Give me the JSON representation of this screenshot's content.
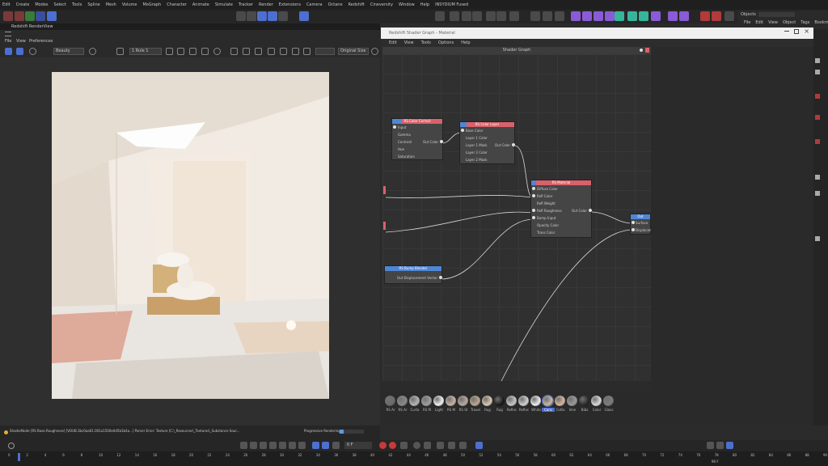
{
  "menubar": [
    "Edit",
    "Create",
    "Modes",
    "Select",
    "Tools",
    "Spline",
    "Mesh",
    "Volume",
    "MoGraph",
    "Character",
    "Animate",
    "Simulate",
    "Tracker",
    "Render",
    "Extensions",
    "Camera",
    "Octane",
    "Redshift",
    "Cineversity",
    "Window",
    "Help",
    "INSYDIUM Fused"
  ],
  "renderview": {
    "title": "Redshift RenderView",
    "menu": [
      "File",
      "View",
      "Preferences"
    ],
    "display_mode": "Beauty",
    "camera_select": "1 Rule 1",
    "color_select": "Original Size",
    "status_text": "ShaderNode [RS Base.Roughness] [VOUB.3bc0aa61.001a1500e0d5b1b4a...] Parser Error: Texture [C:\\_Resources\\_Textures\\_Substance Sour...",
    "progress_text": "Progressive Rendering ...",
    "progress_value": 0.15
  },
  "shader_graph": {
    "window_title": "Redshift Shader Graph - Material",
    "menu": [
      "Edit",
      "View",
      "Tools",
      "Options",
      "Help"
    ],
    "header": "Shader Graph",
    "nodes": {
      "color_correct": {
        "title": "RS Color Correct",
        "inputs": [
          "Input",
          "Gamma",
          "Contrast",
          "Hue",
          "Saturation"
        ],
        "output": "Out Color"
      },
      "color_layer": {
        "title": "RS Color Layer",
        "inputs": [
          "Base Color",
          "Layer 1 Color",
          "Layer 1 Mask",
          "Layer 2 Color",
          "Layer 2 Mask"
        ],
        "output": "Out Color"
      },
      "material": {
        "title": "RS Material",
        "inputs": [
          "Diffuse Color",
          "Refl Color",
          "Refl Weight",
          "Refl Roughness",
          "Bump Input",
          "Opacity Color",
          "Trans Color"
        ],
        "output": "Out Color"
      },
      "bump_blender": {
        "title": "RS Bump Blender",
        "output": "Out Displacement Vector"
      },
      "output": {
        "title": "Out",
        "inputs": [
          "Surface",
          "Displacement"
        ]
      }
    }
  },
  "object_manager": {
    "title": "Objects",
    "tabs": [
      "File",
      "Edit",
      "View",
      "Object",
      "Tags",
      "Bookmarks"
    ]
  },
  "materials": [
    "RS Ar",
    "RS Ar",
    "Curta",
    "RS M",
    "Light",
    "RS M",
    "RS St",
    "Travel",
    "Rug",
    "Rug",
    "Reflec",
    "Reflec",
    "White",
    "Conc",
    "Cotto",
    "Vein",
    "Bibz",
    "Color",
    "Glass"
  ],
  "timeline": {
    "ticks": [
      "0",
      "2",
      "4",
      "6",
      "8",
      "10",
      "12",
      "14",
      "16",
      "18",
      "20",
      "22",
      "24",
      "26",
      "28",
      "30",
      "32",
      "34",
      "36",
      "38",
      "40",
      "42",
      "44",
      "46",
      "48",
      "50",
      "52",
      "54",
      "56",
      "58",
      "60",
      "62",
      "64",
      "66",
      "68",
      "70",
      "72",
      "74",
      "76",
      "78",
      "80",
      "82",
      "84",
      "86",
      "88",
      "90"
    ],
    "current_frame": "0 F",
    "end_frame": "90 F"
  },
  "colors": {
    "header_blue": "#4f86d4",
    "header_red": "#d9626a",
    "accent_blue": "#4d6fcf"
  }
}
